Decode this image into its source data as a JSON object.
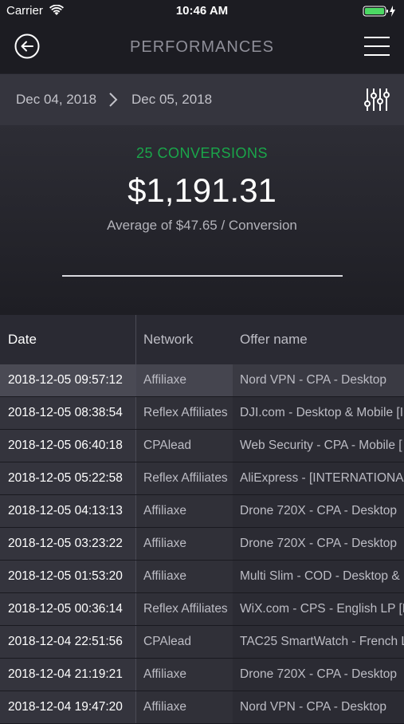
{
  "status": {
    "carrier": "Carrier",
    "time": "10:46 AM"
  },
  "nav": {
    "title": "PERFORMANCES"
  },
  "dates": {
    "from": "Dec 04, 2018",
    "to": "Dec 05, 2018"
  },
  "summary": {
    "conversions": "25 CONVERSIONS",
    "amount": "$1,191.31",
    "average": "Average of $47.65 / Conversion"
  },
  "colors": {
    "accent_green": "#1aa64a",
    "background": "#23232b"
  },
  "table": {
    "headers": [
      "Date",
      "Network",
      "Offer name"
    ],
    "rows": [
      {
        "date": "2018-12-05 09:57:12",
        "network": "Affiliaxe",
        "offer": "Nord VPN - CPA - Desktop"
      },
      {
        "date": "2018-12-05 08:38:54",
        "network": "Reflex Affiliates",
        "offer": "DJI.com - Desktop & Mobile [I"
      },
      {
        "date": "2018-12-05 06:40:18",
        "network": "CPAlead",
        "offer": "Web Security - CPA - Mobile ["
      },
      {
        "date": "2018-12-05 05:22:58",
        "network": "Reflex Affiliates",
        "offer": "AliExpress - [INTERNATIONAL"
      },
      {
        "date": "2018-12-05 04:13:13",
        "network": "Affiliaxe",
        "offer": "Drone 720X - CPA - Desktop"
      },
      {
        "date": "2018-12-05 03:23:22",
        "network": "Affiliaxe",
        "offer": "Drone 720X - CPA - Desktop"
      },
      {
        "date": "2018-12-05 01:53:20",
        "network": "Affiliaxe",
        "offer": "Multi Slim - COD - Desktop &"
      },
      {
        "date": "2018-12-05 00:36:14",
        "network": "Reflex Affiliates",
        "offer": "WiX.com - CPS - English LP [E"
      },
      {
        "date": "2018-12-04 22:51:56",
        "network": "CPAlead",
        "offer": "TAC25 SmartWatch - French L"
      },
      {
        "date": "2018-12-04 21:19:21",
        "network": "Affiliaxe",
        "offer": "Drone 720X - CPA - Desktop"
      },
      {
        "date": "2018-12-04 19:47:20",
        "network": "Affiliaxe",
        "offer": "Nord VPN - CPA - Desktop"
      }
    ]
  }
}
